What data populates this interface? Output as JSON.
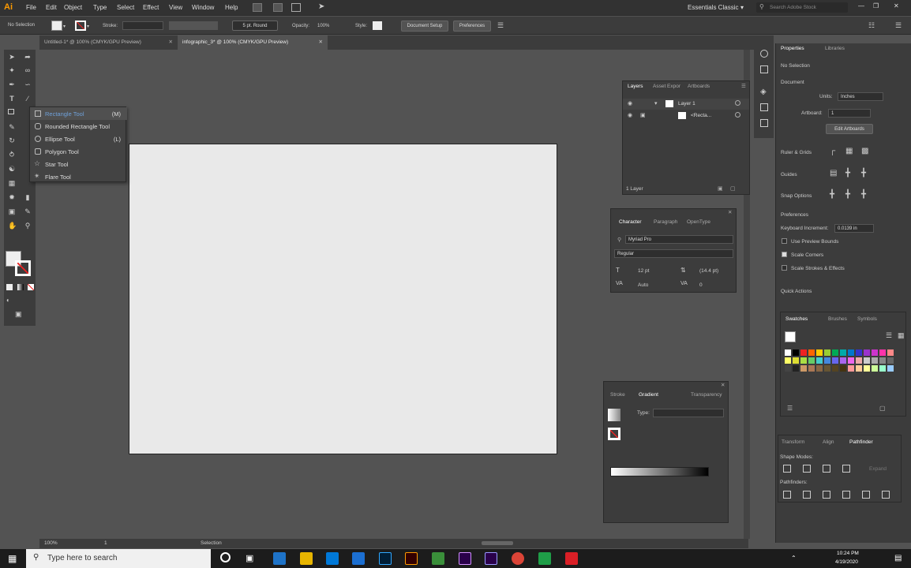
{
  "menubar": {
    "logo": "Ai",
    "items": [
      "File",
      "Edit",
      "Object",
      "Type",
      "Select",
      "Effect",
      "View",
      "Window",
      "Help"
    ],
    "workspace": "Essentials Classic",
    "search_placeholder": "Search Adobe Stock"
  },
  "controlbar": {
    "selection": "No Selection",
    "stroke_label": "Stroke:",
    "brush": "5 pt. Round",
    "opacity_label": "Opacity:",
    "opacity_value": "100%",
    "style_label": "Style:",
    "document_setup": "Document Setup",
    "preferences": "Preferences"
  },
  "tabs": [
    {
      "label": "Untitled-1* @ 100% (CMYK/GPU Preview)"
    },
    {
      "label": "infographic_3* @ 100% (CMYK/GPU Preview)"
    }
  ],
  "flyout": {
    "items": [
      {
        "label": "Rectangle Tool",
        "key": "(M)"
      },
      {
        "label": "Rounded Rectangle Tool",
        "key": ""
      },
      {
        "label": "Ellipse Tool",
        "key": "(L)"
      },
      {
        "label": "Polygon Tool",
        "key": ""
      },
      {
        "label": "Star Tool",
        "key": ""
      },
      {
        "label": "Flare Tool",
        "key": ""
      }
    ]
  },
  "layers": {
    "tabs": [
      "Layers",
      "Asset Expor",
      "Artboards"
    ],
    "layer_name": "Layer 1",
    "sublayer": "<Recta...",
    "count": "1 Layer"
  },
  "character": {
    "tabs": [
      "Character",
      "Paragraph",
      "OpenType"
    ],
    "font": "Myriad Pro",
    "style": "Regular",
    "size": "12 pt",
    "leading": "(14.4 pt)",
    "kerning": "Auto",
    "tracking": "0"
  },
  "gradient": {
    "tabs": [
      "Stroke",
      "Gradient",
      "Transparency"
    ],
    "type_label": "Type:"
  },
  "properties": {
    "tabs": [
      "Properties",
      "Libraries"
    ],
    "selection": "No Selection",
    "document": "Document",
    "units_label": "Units:",
    "units_value": "Inches",
    "artboard_label": "Artboard:",
    "artboard_value": "1",
    "edit_artboards": "Edit Artboards",
    "ruler_grids": "Ruler & Grids",
    "guides": "Guides",
    "snap_options": "Snap Options",
    "preferences": "Preferences",
    "keyboard_increment_label": "Keyboard Increment:",
    "keyboard_increment_value": "0.0139 in",
    "use_preview_bounds": "Use Preview Bounds",
    "scale_corners": "Scale Corners",
    "scale_strokes": "Scale Strokes & Effects",
    "quick_actions": "Quick Actions"
  },
  "swatches": {
    "tabs": [
      "Swatches",
      "Brushes",
      "Symbols"
    ]
  },
  "pathfinder": {
    "tabs": [
      "Transform",
      "Align",
      "Pathfinder"
    ],
    "shape_modes": "Shape Modes:",
    "pathfinders": "Pathfinders:",
    "expand": "Expand"
  },
  "statusbar": {
    "zoom": "100%",
    "artboard": "1",
    "tool": "Selection"
  },
  "taskbar": {
    "search_placeholder": "Type here to search",
    "time": "10:24 PM",
    "date": "4/19/2020"
  }
}
